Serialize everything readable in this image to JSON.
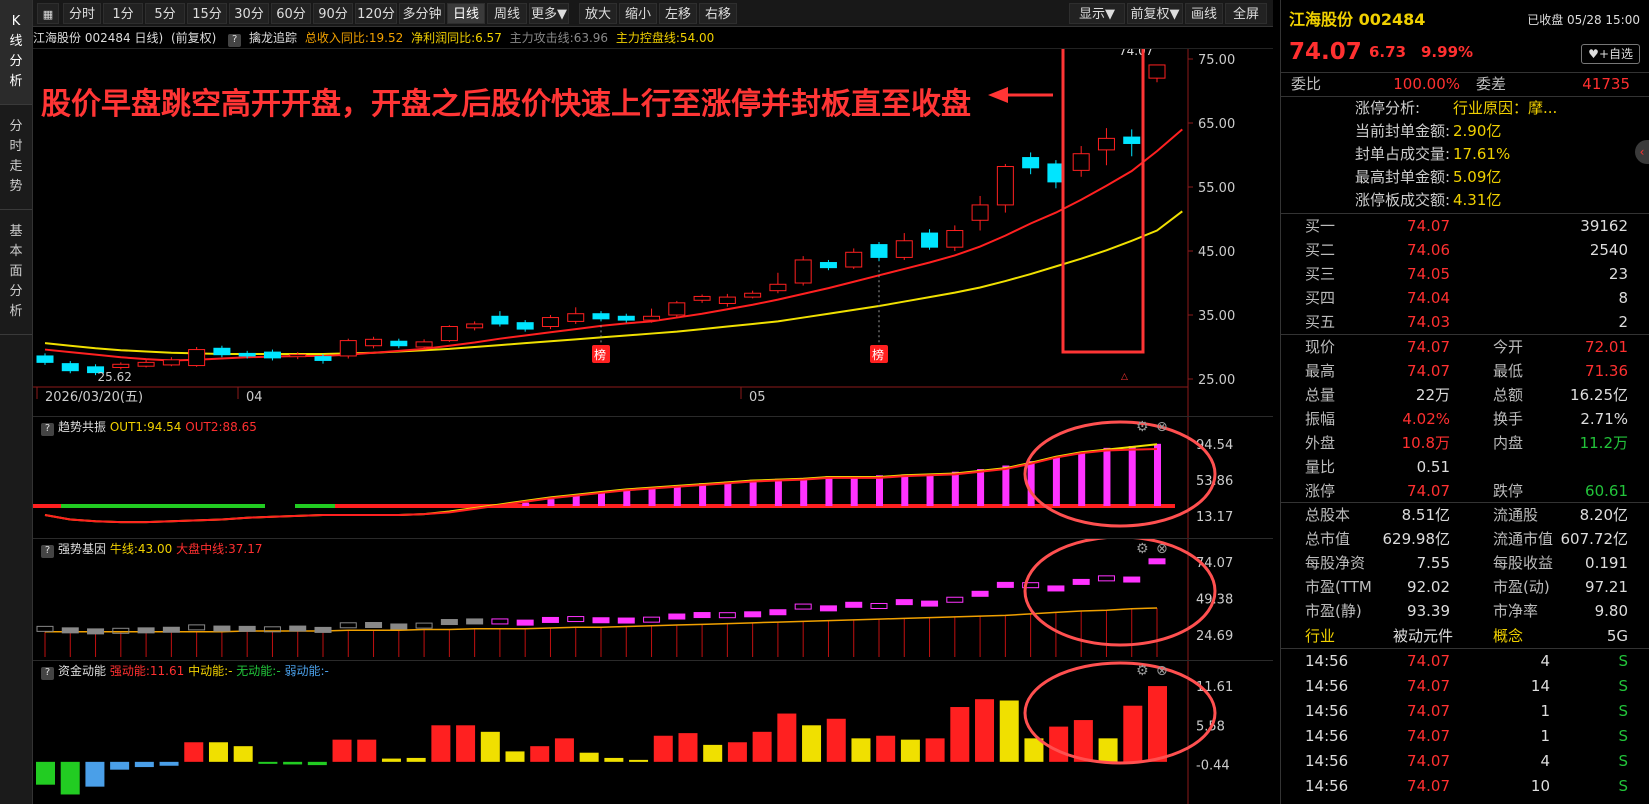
{
  "leftnav": [
    {
      "label": "K\n线\n分\n析",
      "active": true
    },
    {
      "label": "分\n时\n走\n势",
      "active": false
    },
    {
      "label": "基\n本\n面\n分\n析",
      "active": false
    }
  ],
  "toolbar": {
    "periods": [
      "分时",
      "1分",
      "5分",
      "15分",
      "30分",
      "60分",
      "90分",
      "120分",
      "多分钟",
      "日线",
      "周线",
      "更多▼"
    ],
    "active_period": "日线",
    "actions": [
      "放大",
      "缩小",
      "左移",
      "右移"
    ],
    "right_actions": [
      "显示▼",
      "前复权▼",
      "画线",
      "全屏"
    ]
  },
  "infobar": {
    "stock": "江海股份 002484 日线)",
    "adjust": "(前复权)",
    "indicator": "擒龙追踪",
    "rev": "总收入同比:19.52",
    "profit": "净利润同比:6.57",
    "attack": "主力攻击线:63.96",
    "control": "主力控盘线:54.00"
  },
  "chart_data": [
    {
      "type": "candlestick",
      "name": "kline",
      "y_ticks": [
        "75.00",
        "65.00",
        "55.00",
        "45.00",
        "35.00",
        "25.00"
      ],
      "ylim": [
        25,
        75
      ],
      "x_labels": [
        "2026/03/20(五)",
        "04",
        "05"
      ],
      "low_label": "25.62",
      "high_label": "74.07",
      "rank_marks": [
        "榜",
        "榜"
      ],
      "candles": [
        {
          "o": 28.6,
          "c": 27.6,
          "h": 29.0,
          "l": 27.2
        },
        {
          "o": 27.4,
          "c": 26.3,
          "h": 27.8,
          "l": 25.9
        },
        {
          "o": 26.9,
          "c": 26.0,
          "h": 27.3,
          "l": 25.6
        },
        {
          "o": 26.8,
          "c": 27.3,
          "h": 27.6,
          "l": 26.5
        },
        {
          "o": 27.0,
          "c": 27.6,
          "h": 28.0,
          "l": 26.8
        },
        {
          "o": 27.2,
          "c": 28.0,
          "h": 28.4,
          "l": 27.0
        },
        {
          "o": 27.1,
          "c": 29.6,
          "h": 30.0,
          "l": 26.9
        },
        {
          "o": 29.8,
          "c": 28.8,
          "h": 30.2,
          "l": 28.4
        },
        {
          "o": 29.0,
          "c": 28.6,
          "h": 29.4,
          "l": 28.2
        },
        {
          "o": 29.2,
          "c": 28.3,
          "h": 29.6,
          "l": 27.9
        },
        {
          "o": 28.5,
          "c": 28.8,
          "h": 29.2,
          "l": 28.1
        },
        {
          "o": 28.5,
          "c": 27.9,
          "h": 28.9,
          "l": 27.4
        },
        {
          "o": 28.6,
          "c": 31.0,
          "h": 31.3,
          "l": 28.2
        },
        {
          "o": 30.2,
          "c": 31.2,
          "h": 31.6,
          "l": 29.8
        },
        {
          "o": 30.9,
          "c": 30.2,
          "h": 31.3,
          "l": 29.8
        },
        {
          "o": 30.0,
          "c": 30.8,
          "h": 31.2,
          "l": 29.6
        },
        {
          "o": 31.0,
          "c": 33.2,
          "h": 33.4,
          "l": 30.8
        },
        {
          "o": 33.0,
          "c": 33.6,
          "h": 34.0,
          "l": 32.6
        },
        {
          "o": 34.8,
          "c": 33.6,
          "h": 35.6,
          "l": 33.2
        },
        {
          "o": 33.8,
          "c": 32.8,
          "h": 34.2,
          "l": 32.4
        },
        {
          "o": 33.2,
          "c": 34.6,
          "h": 35.0,
          "l": 32.8
        },
        {
          "o": 34.0,
          "c": 35.2,
          "h": 36.2,
          "l": 33.6
        },
        {
          "o": 35.2,
          "c": 34.4,
          "h": 35.6,
          "l": 34.0
        },
        {
          "o": 34.8,
          "c": 34.2,
          "h": 35.2,
          "l": 33.8
        },
        {
          "o": 34.2,
          "c": 34.8,
          "h": 36.0,
          "l": 33.8
        },
        {
          "o": 35.0,
          "c": 36.9,
          "h": 37.2,
          "l": 34.6
        },
        {
          "o": 37.3,
          "c": 37.9,
          "h": 38.2,
          "l": 36.9
        },
        {
          "o": 36.8,
          "c": 37.8,
          "h": 38.3,
          "l": 36.3
        },
        {
          "o": 37.8,
          "c": 38.4,
          "h": 38.8,
          "l": 37.6
        },
        {
          "o": 38.8,
          "c": 39.8,
          "h": 41.6,
          "l": 38.4
        },
        {
          "o": 40.0,
          "c": 43.6,
          "h": 44.2,
          "l": 39.6
        },
        {
          "o": 43.2,
          "c": 42.4,
          "h": 43.6,
          "l": 42.0
        },
        {
          "o": 42.5,
          "c": 44.8,
          "h": 45.4,
          "l": 42.2
        },
        {
          "o": 46.0,
          "c": 44.0,
          "h": 46.4,
          "l": 43.4
        },
        {
          "o": 44.0,
          "c": 46.6,
          "h": 47.8,
          "l": 43.6
        },
        {
          "o": 47.8,
          "c": 45.6,
          "h": 48.4,
          "l": 45.2
        },
        {
          "o": 45.6,
          "c": 48.2,
          "h": 49.0,
          "l": 45.0
        },
        {
          "o": 49.8,
          "c": 52.2,
          "h": 53.6,
          "l": 48.2
        },
        {
          "o": 52.2,
          "c": 58.2,
          "h": 58.6,
          "l": 51.0
        },
        {
          "o": 59.6,
          "c": 58.0,
          "h": 60.4,
          "l": 57.0
        },
        {
          "o": 58.6,
          "c": 55.8,
          "h": 59.2,
          "l": 54.8
        },
        {
          "o": 57.6,
          "c": 60.2,
          "h": 61.4,
          "l": 56.6
        },
        {
          "o": 60.8,
          "c": 62.6,
          "h": 64.2,
          "l": 58.4
        },
        {
          "o": 62.8,
          "c": 61.8,
          "h": 64.0,
          "l": 59.8
        },
        {
          "o": 72.01,
          "c": 74.07,
          "h": 74.07,
          "l": 71.36
        }
      ],
      "ma_red": [
        29.6,
        29.2,
        28.8,
        28.4,
        28.1,
        27.9,
        28.0,
        28.2,
        28.4,
        28.5,
        28.6,
        28.6,
        28.8,
        29.1,
        29.4,
        29.7,
        30.2,
        30.7,
        31.3,
        31.8,
        32.3,
        32.8,
        33.3,
        33.7,
        34.0,
        34.6,
        35.2,
        35.9,
        36.6,
        37.4,
        38.3,
        39.2,
        40.2,
        41.2,
        42.2,
        43.2,
        44.3,
        45.7,
        47.4,
        49.3,
        51.0,
        53.0,
        55.2,
        57.5,
        60.6,
        64.0
      ],
      "ma_yellow": [
        30.6,
        30.2,
        29.8,
        29.5,
        29.3,
        29.1,
        29.0,
        28.9,
        28.9,
        28.9,
        28.9,
        28.9,
        29.0,
        29.1,
        29.3,
        29.5,
        29.7,
        30.0,
        30.3,
        30.6,
        30.9,
        31.2,
        31.5,
        31.8,
        32.1,
        32.4,
        32.8,
        33.2,
        33.6,
        34.0,
        34.6,
        35.2,
        35.8,
        36.4,
        37.1,
        37.8,
        38.5,
        39.3,
        40.3,
        41.4,
        42.6,
        43.8,
        45.1,
        46.6,
        48.2,
        51.2
      ]
    },
    {
      "type": "bar",
      "name": "trend-resonance",
      "title": "趋势共振",
      "out1": "OUT1:94.54",
      "out2": "OUT2:88.65",
      "y_ticks": [
        "94.54",
        "53.86",
        "13.17"
      ],
      "ylim": [
        5,
        100
      ],
      "values": [
        0,
        0,
        0,
        0,
        0,
        0,
        0,
        0,
        0,
        0,
        0,
        0,
        0,
        0,
        0,
        0,
        18,
        20,
        24,
        28,
        32,
        36,
        40,
        43,
        45,
        48,
        50,
        52,
        54,
        55,
        56,
        58,
        58,
        59,
        60,
        61,
        63,
        66,
        70,
        75,
        80,
        85,
        90,
        92,
        94.54
      ],
      "line_yellow": [
        14,
        9,
        7,
        6,
        6,
        7,
        8,
        9,
        11,
        12,
        13,
        14,
        14,
        14,
        14,
        15,
        18,
        22,
        26,
        30,
        34,
        37,
        40,
        43,
        45,
        47,
        49,
        51,
        53,
        54,
        55,
        57,
        57,
        57,
        59,
        60,
        61,
        64,
        67,
        73,
        80,
        85,
        88,
        91,
        94
      ],
      "line_red": [
        14,
        9,
        7,
        6,
        6,
        7,
        8,
        9,
        11,
        12,
        13,
        14,
        14,
        14,
        14,
        15,
        17,
        21,
        25,
        29,
        33,
        36,
        39,
        42,
        44,
        46,
        48,
        50,
        52,
        53,
        54,
        56,
        56,
        56,
        58,
        59,
        60,
        63,
        66,
        72,
        79,
        84,
        87,
        88,
        88.65
      ]
    },
    {
      "type": "bar",
      "name": "strong-gene",
      "title": "强势基因",
      "bull": "牛线:43.00",
      "center": "大盘中线:37.17",
      "y_ticks": [
        "74.07",
        "49.38",
        "24.69"
      ],
      "ylim": [
        10,
        80
      ],
      "boxes": [
        28.6,
        27.6,
        26.9,
        27.3,
        27.6,
        28.0,
        29.6,
        28.8,
        28.6,
        28.3,
        28.8,
        27.9,
        31.0,
        31.2,
        30.2,
        30.8,
        33.2,
        33.6,
        33.6,
        32.8,
        34.6,
        35.2,
        34.4,
        34.2,
        34.8,
        36.9,
        37.9,
        37.8,
        38.4,
        39.8,
        43.6,
        42.4,
        44.8,
        44.0,
        46.6,
        45.6,
        48.2,
        52.2,
        58.2,
        58.0,
        55.8,
        60.2,
        62.6,
        61.8,
        74.07
      ],
      "base_yellow": [
        27,
        27,
        27,
        27,
        27,
        27,
        27,
        27,
        27.5,
        27.5,
        27.5,
        27.5,
        28,
        28,
        28,
        28.5,
        28.5,
        29,
        29,
        29,
        29.5,
        30,
        30,
        30.5,
        31,
        31.5,
        32,
        32.5,
        33,
        33.5,
        34,
        34.5,
        35,
        35.5,
        36,
        36.5,
        37,
        37.5,
        38,
        39,
        40,
        41,
        41.5,
        42.5,
        43
      ]
    },
    {
      "type": "bar",
      "name": "capital-momentum",
      "title": "资金动能",
      "strong": "强动能:11.61",
      "mid": "中动能:-",
      "none": "无动能:-",
      "weak": "弱动能:-",
      "y_ticks": [
        "11.61",
        "5.58",
        "-0.44"
      ],
      "ylim": [
        -6,
        13
      ],
      "bars": [
        {
          "v": -3.5,
          "c": "green"
        },
        {
          "v": -5.0,
          "c": "green"
        },
        {
          "v": -3.8,
          "c": "blue"
        },
        {
          "v": -1.2,
          "c": "blue"
        },
        {
          "v": -0.8,
          "c": "blue"
        },
        {
          "v": -0.6,
          "c": "blue"
        },
        {
          "v": 3.0,
          "c": "red"
        },
        {
          "v": 3.0,
          "c": "yellow"
        },
        {
          "v": 2.4,
          "c": "yellow"
        },
        {
          "v": -0.3,
          "c": "green"
        },
        {
          "v": -0.4,
          "c": "green"
        },
        {
          "v": -0.5,
          "c": "green"
        },
        {
          "v": 3.4,
          "c": "red"
        },
        {
          "v": 3.4,
          "c": "red"
        },
        {
          "v": 0.5,
          "c": "yellow"
        },
        {
          "v": 0.6,
          "c": "yellow"
        },
        {
          "v": 5.6,
          "c": "red"
        },
        {
          "v": 5.6,
          "c": "red"
        },
        {
          "v": 4.6,
          "c": "yellow"
        },
        {
          "v": 1.6,
          "c": "yellow"
        },
        {
          "v": 2.4,
          "c": "red"
        },
        {
          "v": 3.6,
          "c": "red"
        },
        {
          "v": 1.4,
          "c": "yellow"
        },
        {
          "v": 0.6,
          "c": "yellow"
        },
        {
          "v": 0.3,
          "c": "yellow"
        },
        {
          "v": 4.0,
          "c": "red"
        },
        {
          "v": 4.4,
          "c": "red"
        },
        {
          "v": 2.6,
          "c": "yellow"
        },
        {
          "v": 3.0,
          "c": "red"
        },
        {
          "v": 4.6,
          "c": "red"
        },
        {
          "v": 7.4,
          "c": "red"
        },
        {
          "v": 5.6,
          "c": "yellow"
        },
        {
          "v": 6.6,
          "c": "red"
        },
        {
          "v": 3.6,
          "c": "yellow"
        },
        {
          "v": 4.0,
          "c": "red"
        },
        {
          "v": 3.4,
          "c": "yellow"
        },
        {
          "v": 3.6,
          "c": "red"
        },
        {
          "v": 8.4,
          "c": "red"
        },
        {
          "v": 9.6,
          "c": "red"
        },
        {
          "v": 9.4,
          "c": "yellow"
        },
        {
          "v": 3.6,
          "c": "yellow"
        },
        {
          "v": 5.4,
          "c": "red"
        },
        {
          "v": 6.4,
          "c": "red"
        },
        {
          "v": 3.6,
          "c": "yellow"
        },
        {
          "v": 8.6,
          "c": "red"
        },
        {
          "v": 11.61,
          "c": "red"
        }
      ]
    }
  ],
  "annotation": "股价早盘跳空高开开盘，开盘之后股价快速上行至涨停并封板直至收盘",
  "rightpanel": {
    "name": "江海股份 002484",
    "status": "已收盘 05/28 15:00",
    "price": "74.07",
    "change": "6.73",
    "pct": "9.99%",
    "watch_btn": "+自选",
    "wb_label": "委比",
    "wb": "100.00%",
    "wc_label": "委差",
    "wc": "41735",
    "limit_info": [
      {
        "k": "涨停分析:",
        "v": "行业原因：摩..."
      },
      {
        "k": "当前封单金额:",
        "v": "2.90亿"
      },
      {
        "k": "封单占成交量:",
        "v": "17.61%"
      },
      {
        "k": "最高封单金额:",
        "v": "5.09亿"
      },
      {
        "k": "涨停板成交额:",
        "v": "4.31亿"
      }
    ],
    "bids": [
      {
        "k": "买一",
        "p": "74.07",
        "v": "39162"
      },
      {
        "k": "买二",
        "p": "74.06",
        "v": "2540"
      },
      {
        "k": "买三",
        "p": "74.05",
        "v": "23"
      },
      {
        "k": "买四",
        "p": "74.04",
        "v": "8"
      },
      {
        "k": "买五",
        "p": "74.03",
        "v": "2"
      }
    ],
    "quote": [
      {
        "k1": "现价",
        "v1": "74.07",
        "c1": "red",
        "k2": "今开",
        "v2": "72.01",
        "c2": "red"
      },
      {
        "k1": "最高",
        "v1": "74.07",
        "c1": "red",
        "k2": "最低",
        "v2": "71.36",
        "c2": "red"
      },
      {
        "k1": "总量",
        "v1": "22万",
        "c1": "white",
        "k2": "总额",
        "v2": "16.25亿",
        "c2": "white"
      },
      {
        "k1": "振幅",
        "v1": "4.02%",
        "c1": "red",
        "k2": "换手",
        "v2": "2.71%",
        "c2": "white"
      },
      {
        "k1": "外盘",
        "v1": "10.8万",
        "c1": "red",
        "k2": "内盘",
        "v2": "11.2万",
        "c2": "green"
      },
      {
        "k1": "量比",
        "v1": "0.51",
        "c1": "white",
        "k2": "",
        "v2": "",
        "c2": "white"
      },
      {
        "k1": "涨停",
        "v1": "74.07",
        "c1": "red",
        "k2": "跌停",
        "v2": "60.61",
        "c2": "green"
      }
    ],
    "fundamentals": [
      {
        "k1": "总股本",
        "v1": "8.51亿",
        "k2": "流通股",
        "v2": "8.20亿"
      },
      {
        "k1": "总市值",
        "v1": "629.98亿",
        "k2": "流通市值",
        "v2": "607.72亿"
      },
      {
        "k1": "每股净资",
        "v1": "7.55",
        "k2": "每股收益",
        "v2": "0.191"
      },
      {
        "k1": "市盈(TTM",
        "v1": "92.02",
        "k2": "市盈(动)",
        "v2": "97.21"
      },
      {
        "k1": "市盈(静)",
        "v1": "93.39",
        "k2": "市净率",
        "v2": "9.80"
      }
    ],
    "industry_label": "行业",
    "industry": "被动元件",
    "concept_label": "概念",
    "concept": "5G",
    "ticks": [
      {
        "t": "14:56",
        "p": "74.07",
        "v": "4",
        "s": "S"
      },
      {
        "t": "14:56",
        "p": "74.07",
        "v": "14",
        "s": "S"
      },
      {
        "t": "14:56",
        "p": "74.07",
        "v": "1",
        "s": "S"
      },
      {
        "t": "14:56",
        "p": "74.07",
        "v": "1",
        "s": "S"
      },
      {
        "t": "14:56",
        "p": "74.07",
        "v": "4",
        "s": "S"
      },
      {
        "t": "14:56",
        "p": "74.07",
        "v": "10",
        "s": "S"
      }
    ]
  }
}
